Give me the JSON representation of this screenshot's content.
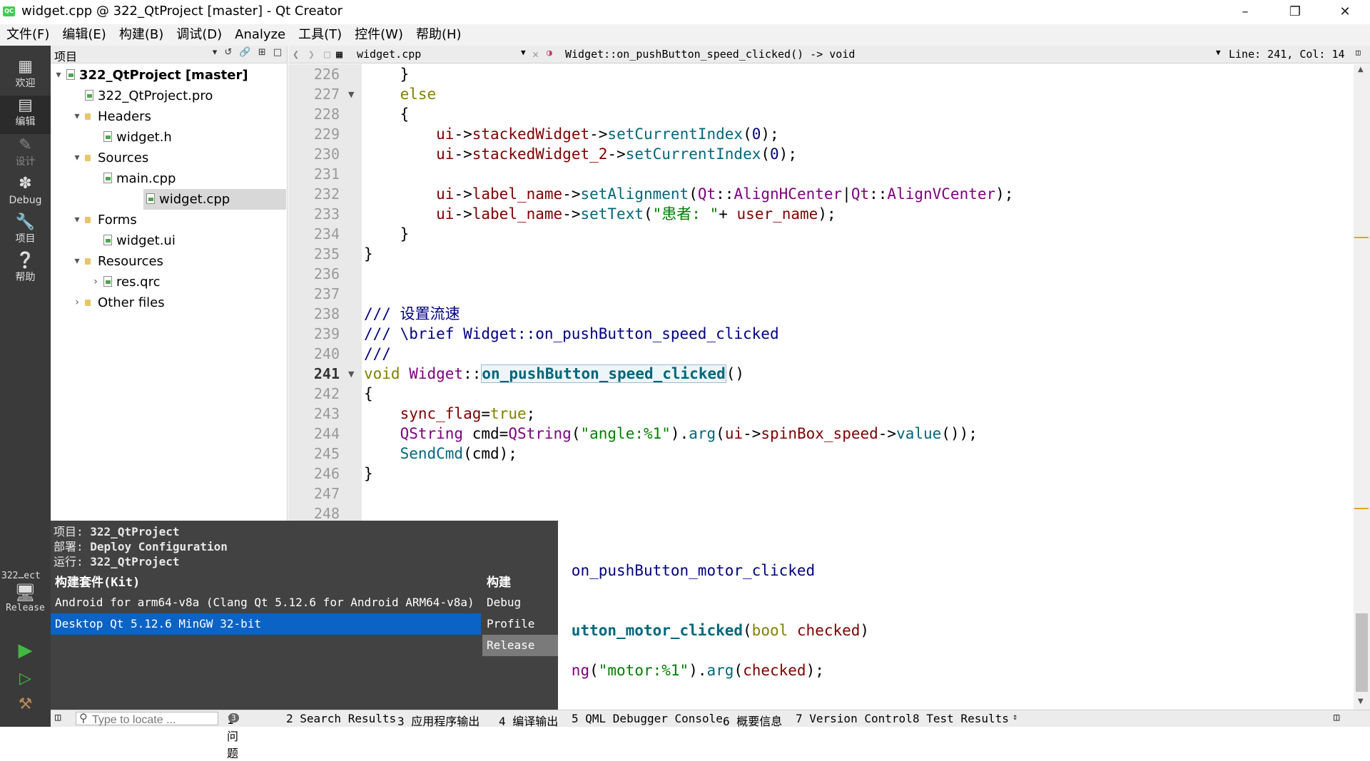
{
  "window": {
    "title": "widget.cpp @ 322_QtProject [master] - Qt Creator",
    "app_icon_text": "QC"
  },
  "menu": [
    "文件(F)",
    "编辑(E)",
    "构建(B)",
    "调试(D)",
    "Analyze",
    "工具(T)",
    "控件(W)",
    "帮助(H)"
  ],
  "modes": [
    {
      "label": "欢迎",
      "icon": "grid-icon"
    },
    {
      "label": "编辑",
      "icon": "edit-icon"
    },
    {
      "label": "设计",
      "icon": "pencil-icon"
    },
    {
      "label": "Debug",
      "icon": "bug-icon"
    },
    {
      "label": "项目",
      "icon": "wrench-icon"
    },
    {
      "label": "帮助",
      "icon": "help-icon"
    }
  ],
  "project_pane": {
    "title": "项目",
    "tree": [
      {
        "label": "322_QtProject [master]",
        "level": 0,
        "arrow": "▾",
        "bold": true
      },
      {
        "label": "322_QtProject.pro",
        "level": 1,
        "arrow": ""
      },
      {
        "label": "Headers",
        "level": 1,
        "arrow": "▾"
      },
      {
        "label": "widget.h",
        "level": 2,
        "arrow": ""
      },
      {
        "label": "Sources",
        "level": 1,
        "arrow": "▾"
      },
      {
        "label": "main.cpp",
        "level": 2,
        "arrow": ""
      },
      {
        "label": "widget.cpp",
        "level": 2,
        "arrow": "",
        "selected": true
      },
      {
        "label": "Forms",
        "level": 1,
        "arrow": "▾"
      },
      {
        "label": "widget.ui",
        "level": 2,
        "arrow": ""
      },
      {
        "label": "Resources",
        "level": 1,
        "arrow": "▾"
      },
      {
        "label": "res.qrc",
        "level": 2,
        "arrow": "›"
      },
      {
        "label": "Other files",
        "level": 1,
        "arrow": "›"
      }
    ]
  },
  "editor": {
    "file": "widget.cpp",
    "function": "Widget::on_pushButton_speed_clicked() -> void",
    "position": "Line: 241, Col: 14",
    "line_numbers": [
      "226",
      "227",
      "228",
      "229",
      "230",
      "231",
      "232",
      "233",
      "234",
      "235",
      "236",
      "237",
      "238",
      "239",
      "240",
      "241",
      "242",
      "243",
      "244",
      "245",
      "246",
      "247",
      "248"
    ],
    "current_line": "241"
  },
  "kit_popup": {
    "project_label": "项目:",
    "project_value": "322_QtProject",
    "deploy_label": "部署:",
    "deploy_value": "Deploy Configuration",
    "run_label": "运行:",
    "run_value": "322_QtProject",
    "kit_header": "构建套件(Kit)",
    "build_header": "构建",
    "kits": [
      "Android for arm64-v8a (Clang Qt 5.12.6 for Android ARM64-v8a)",
      "Desktop Qt 5.12.6 MinGW 32-bit"
    ],
    "builds": [
      "Debug",
      "Profile",
      "Release"
    ]
  },
  "kit_selector": {
    "project": "322…ect",
    "build": "Release"
  },
  "statusbar": {
    "locate_placeholder": "Type to locate ...",
    "tabs": [
      "1 问题",
      "2 Search Results",
      "3 应用程序输出",
      "4 编译输出",
      "5 QML Debugger Console",
      "6 概要信息",
      "7 Version Control",
      "8 Test Results"
    ],
    "issues_count": "3"
  }
}
